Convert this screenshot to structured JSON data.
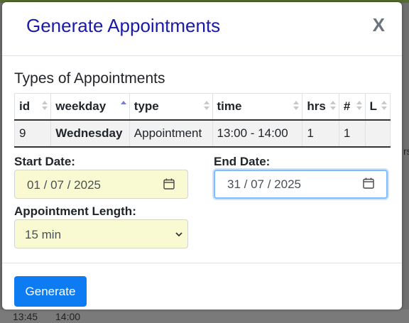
{
  "modal": {
    "title": "Generate Appointments",
    "close_label": "X"
  },
  "types_section": {
    "title": "Types of Appointments",
    "columns": [
      "id",
      "weekday",
      "type",
      "time",
      "hrs",
      "#",
      "L"
    ],
    "sorted_column": "weekday",
    "rows": [
      {
        "id": "9",
        "weekday": "Wednesday",
        "type": "Appointment",
        "time": "13:00 - 14:00",
        "hrs": "1",
        "count": "1",
        "l": ""
      }
    ]
  },
  "form": {
    "start_date_label": "Start Date:",
    "start_date_value": "01 / 07 / 2025",
    "end_date_label": "End Date:",
    "end_date_value": "31 / 07 / 2025",
    "length_label": "Appointment Length:",
    "length_value": "15 min"
  },
  "footer": {
    "generate_label": "Generate"
  },
  "background": {
    "bottom_left": "13:45",
    "bottom_mid": "14:00",
    "side_text": "rs"
  },
  "colors": {
    "title": "#1a1aa6",
    "primary": "#0d7cf2",
    "input_bg": "#fafad2",
    "focus_border": "#80bdff"
  }
}
